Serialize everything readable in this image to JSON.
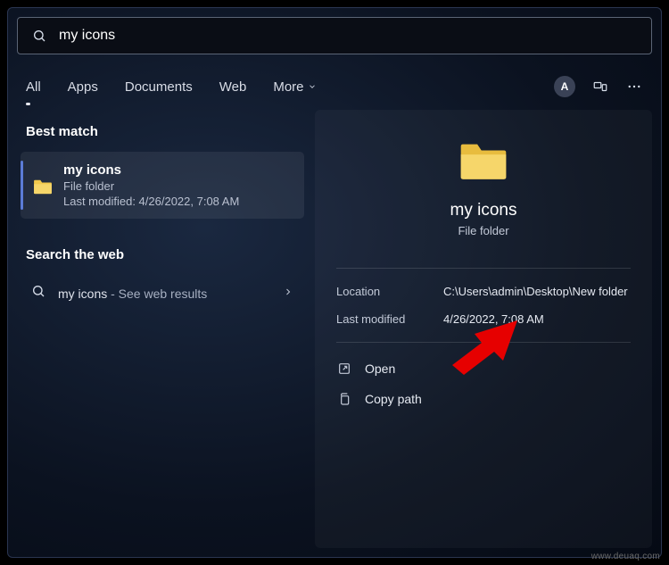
{
  "search": {
    "value": "my icons"
  },
  "tabs": {
    "all": "All",
    "apps": "Apps",
    "documents": "Documents",
    "web": "Web",
    "more": "More"
  },
  "avatar_letter": "A",
  "left": {
    "best_match_heading": "Best match",
    "match": {
      "title": "my icons",
      "type": "File folder",
      "modified": "Last modified: 4/26/2022, 7:08 AM"
    },
    "search_web_heading": "Search the web",
    "web_primary": "my icons",
    "web_suffix": " - See web results"
  },
  "right": {
    "title": "my icons",
    "subtitle": "File folder",
    "location_key": "Location",
    "location_val": "C:\\Users\\admin\\Desktop\\New folder",
    "modified_key": "Last modified",
    "modified_val": "4/26/2022, 7:08 AM",
    "open": "Open",
    "copy_path": "Copy path"
  },
  "watermark": "www.deuaq.com"
}
